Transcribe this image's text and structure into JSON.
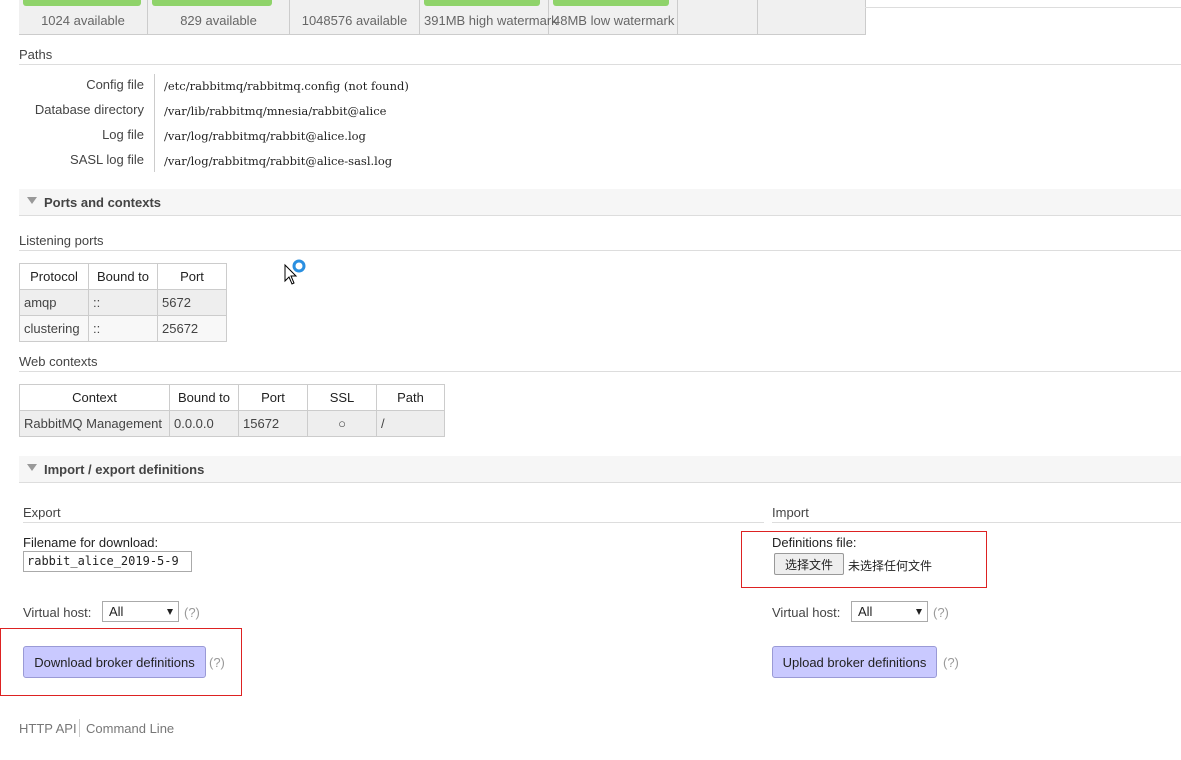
{
  "stats": [
    {
      "label": "1024 available"
    },
    {
      "label": "829 available"
    },
    {
      "label": "1048576 available"
    },
    {
      "label": "391MB high watermark"
    },
    {
      "label": "48MB low watermark"
    }
  ],
  "paths": {
    "heading": "Paths",
    "rows": [
      {
        "label": "Config file",
        "value": "/etc/rabbitmq/rabbitmq.config (not found)"
      },
      {
        "label": "Database directory",
        "value": "/var/lib/rabbitmq/mnesia/rabbit@alice"
      },
      {
        "label": "Log file",
        "value": "/var/log/rabbitmq/rabbit@alice.log"
      },
      {
        "label": "SASL log file",
        "value": "/var/log/rabbitmq/rabbit@alice-sasl.log"
      }
    ]
  },
  "ports_section": {
    "title": "Ports and contexts",
    "listening_heading": "Listening ports",
    "listening_columns": [
      "Protocol",
      "Bound to",
      "Port"
    ],
    "listening_rows": [
      [
        "amqp",
        "::",
        "5672"
      ],
      [
        "clustering",
        "::",
        "25672"
      ]
    ],
    "web_heading": "Web contexts",
    "web_columns": [
      "Context",
      "Bound to",
      "Port",
      "SSL",
      "Path"
    ],
    "web_rows": [
      [
        "RabbitMQ Management",
        "0.0.0.0",
        "15672",
        "○",
        "/"
      ]
    ]
  },
  "defs_section": {
    "title": "Import / export definitions",
    "export": {
      "heading": "Export",
      "filename_label": "Filename for download:",
      "filename_value": "rabbit_alice_2019-5-9",
      "vhost_label": "Virtual host:",
      "vhost_value": "All",
      "button": "Download broker definitions",
      "help": "(?)"
    },
    "import": {
      "heading": "Import",
      "file_label": "Definitions file:",
      "choose_button": "选择文件",
      "no_file": "未选择任何文件",
      "vhost_label": "Virtual host:",
      "vhost_value": "All",
      "button": "Upload broker definitions",
      "help": "(?)"
    }
  },
  "footer": {
    "links": [
      "HTTP API",
      "Command Line"
    ]
  }
}
